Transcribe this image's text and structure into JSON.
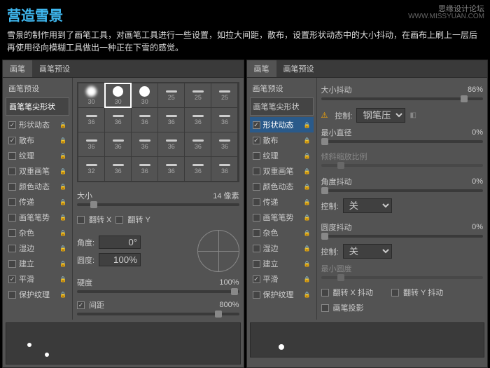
{
  "header": {
    "title": "营造雪景",
    "watermark1": "思缘设计论坛",
    "watermark2": "WWW.MISSYUAN.COM"
  },
  "description": "雪景的制作用到了画笔工具，对画笔工具进行一些设置，如拉大间距，散布，设置形状动态中的大小抖动，在画布上刷上一层后再使用径向模糊工具做出一种正在下雪的感觉。",
  "tabs": {
    "brush": "画笔",
    "preset": "画笔预设"
  },
  "side": {
    "preset": "画笔预设",
    "tip": "画笔笔尖形状",
    "shape": "形状动态",
    "scatter": "散布",
    "texture": "纹理",
    "dual": "双重画笔",
    "color": "颜色动态",
    "transfer": "传递",
    "pose": "画笔笔势",
    "misc": "杂色",
    "wet": "湿边",
    "build": "建立",
    "smooth": "平滑",
    "protect": "保护纹理"
  },
  "p1": {
    "sizes": [
      "30",
      "30",
      "30",
      "25",
      "25",
      "25",
      "36",
      "36",
      "36",
      "36",
      "36",
      "36",
      "36",
      "36",
      "36",
      "36",
      "36",
      "36",
      "32",
      "36",
      "36",
      "36",
      "36",
      "36"
    ],
    "size_lbl": "大小",
    "size_val": "14 像素",
    "flipx": "翻转 X",
    "flipy": "翻转 Y",
    "angle_lbl": "角度:",
    "angle_val": "0°",
    "round_lbl": "圆度:",
    "round_val": "100%",
    "hard_lbl": "硬度",
    "hard_val": "100%",
    "spacing_lbl": "间距",
    "spacing_val": "800%"
  },
  "p2": {
    "jitter_lbl": "大小抖动",
    "jitter_val": "86%",
    "ctrl_lbl": "控制:",
    "ctrl_val": "钢笔压力",
    "mindia_lbl": "最小直径",
    "mindia_val": "0%",
    "tilt_lbl": "倾斜缩放比例",
    "angj_lbl": "角度抖动",
    "angj_val": "0%",
    "ctrl2_lbl": "控制:",
    "ctrl2_val": "关",
    "rndj_lbl": "圆度抖动",
    "rndj_val": "0%",
    "ctrl3_lbl": "控制:",
    "ctrl3_val": "关",
    "minr_lbl": "最小圆度",
    "flipxj": "翻转 X 抖动",
    "flipyj": "翻转 Y 抖动",
    "proj": "画笔投影"
  }
}
